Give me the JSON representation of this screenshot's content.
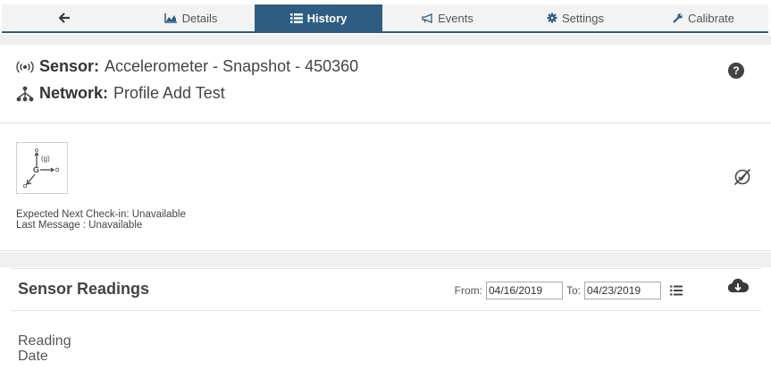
{
  "tabs": [
    {
      "id": "back",
      "label": "",
      "icon": "arrow-left-icon"
    },
    {
      "id": "details",
      "label": "Details",
      "icon": "area-chart-icon"
    },
    {
      "id": "history",
      "label": "History",
      "icon": "list-icon",
      "active": true
    },
    {
      "id": "events",
      "label": "Events",
      "icon": "bullhorn-icon"
    },
    {
      "id": "settings",
      "label": "Settings",
      "icon": "gear-icon"
    },
    {
      "id": "calibrate",
      "label": "Calibrate",
      "icon": "wrench-icon"
    }
  ],
  "sensor": {
    "label": "Sensor:",
    "name": "Accelerometer - Snapshot - 450360"
  },
  "network": {
    "label": "Network:",
    "name": "Profile Add Test"
  },
  "status": {
    "expected_checkin": "Expected Next Check-in: Unavailable",
    "last_message": "Last Message : Unavailable"
  },
  "readings": {
    "title": "Sensor Readings",
    "from_label": "From:",
    "from_value": "04/16/2019",
    "to_label": "To:",
    "to_value": "04/23/2019",
    "column_reading": "Reading",
    "column_date": "Date"
  },
  "colors": {
    "tab_active_bg": "#2e5d84",
    "tab_bg": "#f3f3f3",
    "band_gray": "#efefef"
  }
}
